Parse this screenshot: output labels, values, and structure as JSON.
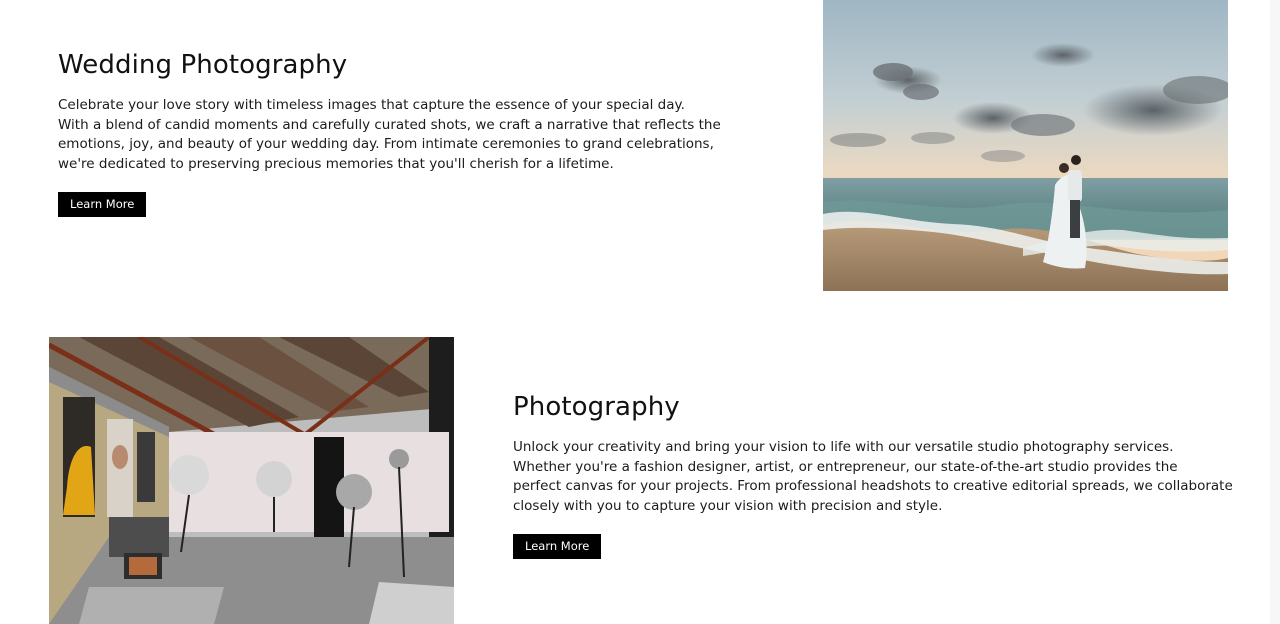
{
  "sections": [
    {
      "title": "Wedding Photography",
      "body_lines": [
        "Celebrate your love story with timeless images that capture the essence of your special day.",
        "With a blend of candid moments and carefully curated shots, we craft a narrative that reflects the",
        "emotions, joy, and beauty of your wedding day. From intimate ceremonies to grand celebrations,",
        "we're dedicated to preserving precious memories that you'll cherish for a lifetime."
      ],
      "button_label": "Learn More"
    },
    {
      "title": "Photography",
      "body_lines": [
        "Unlock your creativity and bring your vision to life with our versatile studio photography services.",
        "Whether you're a fashion designer, artist, or entrepreneur, our state-of-the-art studio provides the",
        "perfect canvas for your projects. From professional headshots to creative editorial spreads, we collaborate",
        "closely with you to capture your vision with precision and style."
      ],
      "button_label": "Learn More"
    }
  ],
  "colors": {
    "button_bg": "#000000",
    "button_text": "#ffffff",
    "text": "#111111",
    "background": "#ffffff"
  }
}
